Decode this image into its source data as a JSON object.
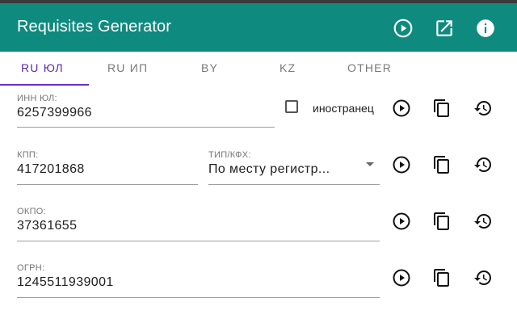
{
  "app": {
    "title": "Requisites Generator",
    "colors": {
      "primary": "#0f8a7e",
      "tab_accent": "#6a2fc0"
    },
    "header_icons": [
      "play-circle-icon",
      "open-in-new-icon",
      "info-icon"
    ]
  },
  "tabs": [
    {
      "label": "RU ЮЛ",
      "active": true
    },
    {
      "label": "RU ИП",
      "active": false
    },
    {
      "label": "BY",
      "active": false
    },
    {
      "label": "KZ",
      "active": false
    },
    {
      "label": "OTHER",
      "active": false
    }
  ],
  "fields": {
    "inn": {
      "label": "ИНН ЮЛ:",
      "value": "6257399966"
    },
    "foreign": {
      "label": "иностранец",
      "checked": false
    },
    "kpp": {
      "label": "КПП:",
      "value": "417201868"
    },
    "kpp_type": {
      "label": "ТИП/КФХ:",
      "value": "По месту регистр..."
    },
    "okpo": {
      "label": "ОКПО:",
      "value": "37361655"
    },
    "ogrn": {
      "label": "ОГРН:",
      "value": "1245511939001"
    }
  },
  "row_actions": [
    "generate-play-icon",
    "copy-icon",
    "history-restore-icon"
  ]
}
